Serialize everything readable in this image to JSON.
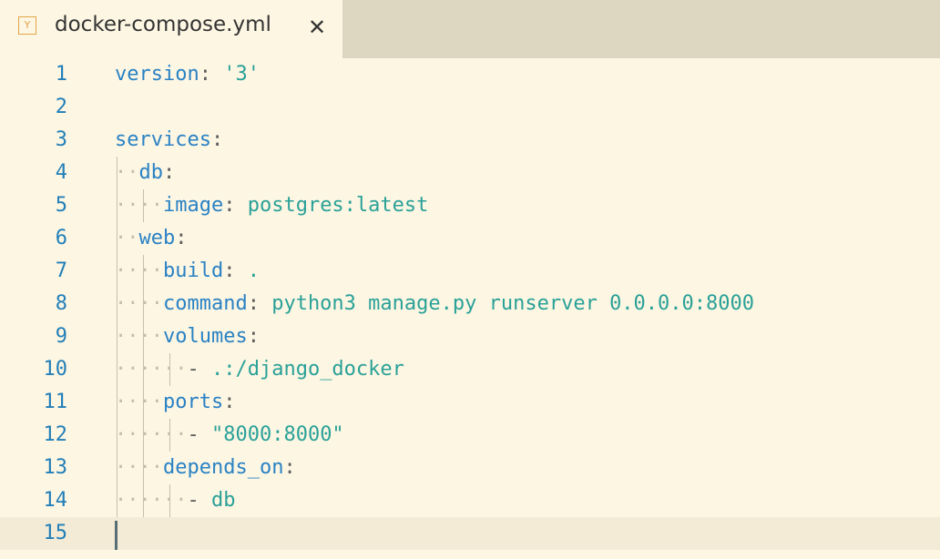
{
  "tab": {
    "icon": "yaml-file-icon",
    "icon_glyph": "Y",
    "title": "docker-compose.yml",
    "close_glyph": "✕"
  },
  "editor": {
    "lines": [
      {
        "num": "1",
        "indent": 0,
        "key": "version",
        "value": "'3'"
      },
      {
        "num": "2",
        "indent": 0
      },
      {
        "num": "3",
        "indent": 0,
        "key": "services"
      },
      {
        "num": "4",
        "indent": 1,
        "key": "db"
      },
      {
        "num": "5",
        "indent": 2,
        "key": "image",
        "value": "postgres:latest"
      },
      {
        "num": "6",
        "indent": 1,
        "key": "web"
      },
      {
        "num": "7",
        "indent": 2,
        "key": "build",
        "value": "."
      },
      {
        "num": "8",
        "indent": 2,
        "key": "command",
        "value": "python3 manage.py runserver 0.0.0.0:8000"
      },
      {
        "num": "9",
        "indent": 2,
        "key": "volumes"
      },
      {
        "num": "10",
        "indent": 3,
        "item": ".:/django_docker"
      },
      {
        "num": "11",
        "indent": 2,
        "key": "ports"
      },
      {
        "num": "12",
        "indent": 3,
        "item": "\"8000:8000\""
      },
      {
        "num": "13",
        "indent": 2,
        "key": "depends_on"
      },
      {
        "num": "14",
        "indent": 3,
        "item": "db"
      },
      {
        "num": "15",
        "indent": 0,
        "current": true
      }
    ]
  },
  "colors": {
    "background": "#fdf6e3",
    "tabbar": "#ddd6c1",
    "key": "#2a82c4",
    "string": "#2aa198",
    "line_number": "#227fb8",
    "whitespace_dot": "#c5bfa8"
  }
}
